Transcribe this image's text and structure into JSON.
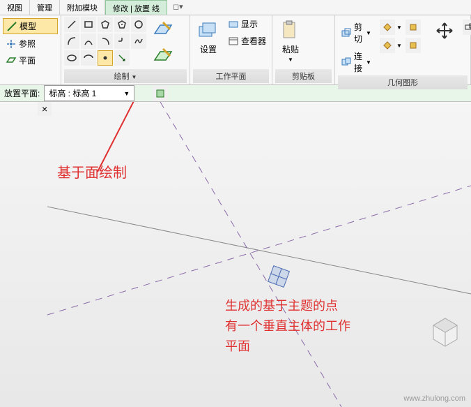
{
  "tabs": {
    "view": "视图",
    "manage": "管理",
    "addon": "附加模块",
    "modify": "修改 | 放置 线"
  },
  "ribbon": {
    "draw_panel": {
      "model": "模型",
      "reference": "参照",
      "plane": "平面",
      "title": "绘制"
    },
    "workplane_panel": {
      "set": "设置",
      "show": "显示",
      "viewer": "查看器",
      "title": "工作平面"
    },
    "clipboard_panel": {
      "paste": "粘贴",
      "cut": "剪切",
      "connect": "连接",
      "title": "剪贴板"
    },
    "geometry_panel": {
      "title": "几何图形"
    }
  },
  "options": {
    "label": "放置平面:",
    "value": "标高 : 标高 1"
  },
  "annotations": {
    "a1": "基于面绘制",
    "a2_l1": "生成的基于主题的点",
    "a2_l2": "有一个垂直主体的工作",
    "a2_l3": "平面"
  },
  "watermark": "www.zhulong.com"
}
